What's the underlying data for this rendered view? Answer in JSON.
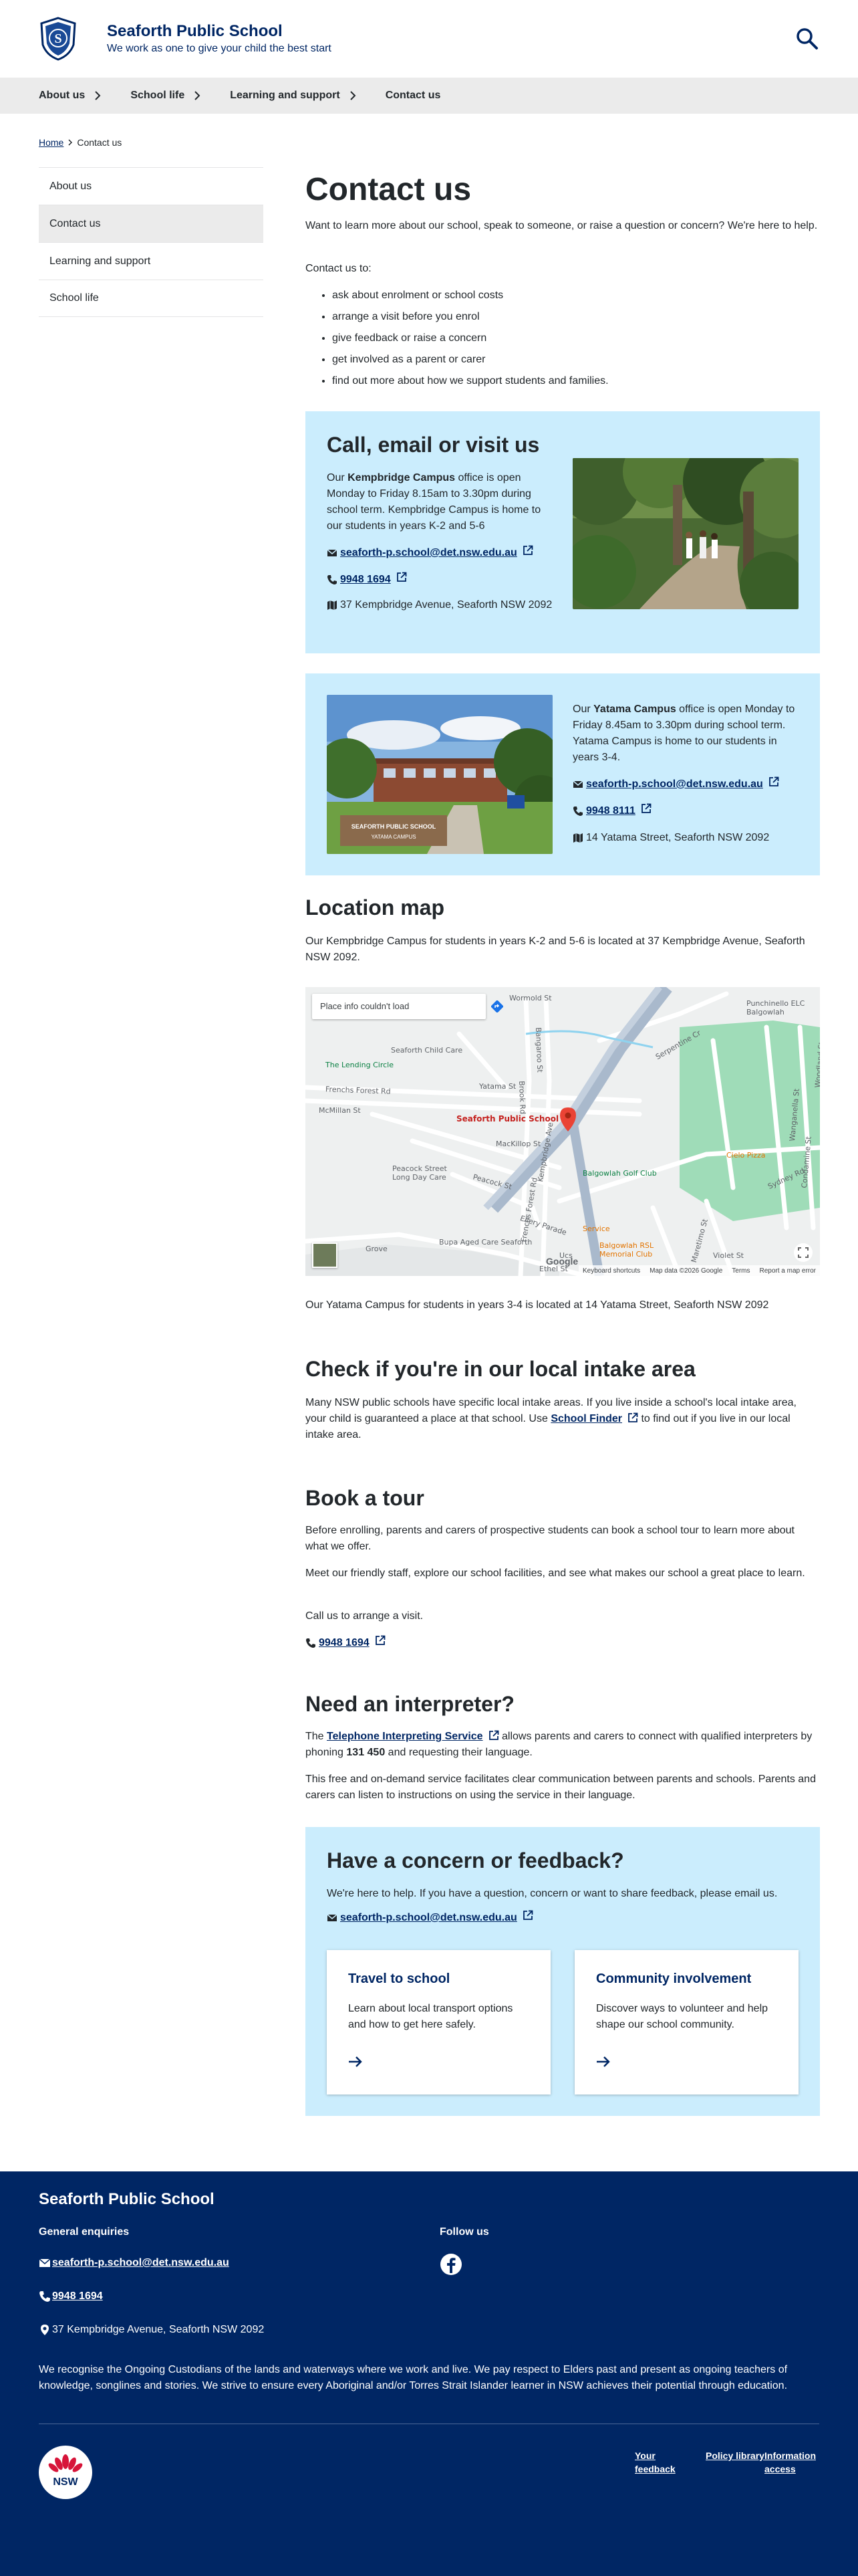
{
  "header": {
    "school_name": "Seaforth Public School",
    "tagline": "We work as one to give your child the best start",
    "crest_initial": "S"
  },
  "nav": {
    "items": [
      {
        "label": "About us",
        "has_chevron": true
      },
      {
        "label": "School life",
        "has_chevron": true
      },
      {
        "label": "Learning and support",
        "has_chevron": true
      },
      {
        "label": "Contact us",
        "has_chevron": false
      }
    ]
  },
  "breadcrumb": {
    "home": "Home",
    "current": "Contact us"
  },
  "sidebar": {
    "items": [
      {
        "label": "About us"
      },
      {
        "label": "Contact us",
        "active": true
      },
      {
        "label": "Learning and support"
      },
      {
        "label": "School life"
      }
    ]
  },
  "page": {
    "title": "Contact us",
    "intro": "Want to learn more about our school, speak to someone, or raise a question or concern? We're here to help.",
    "list_lead": "Contact us to:",
    "reasons": [
      "ask about enrolment or school costs",
      "arrange a visit before you enrol",
      "give feedback or raise a concern",
      "get involved as a parent or carer",
      "find out more about how we support students and families."
    ]
  },
  "contact": {
    "heading": "Call, email or visit us",
    "kempbridge": {
      "text_pre": "Our ",
      "name": "Kempbridge Campus",
      "text_post": " office is open Monday to Friday 8.15am to 3.30pm during school term. Kempbridge Campus is home to our students in years K-2 and 5-6",
      "email": "seaforth-p.school@det.nsw.edu.au",
      "phone": "9948 1694",
      "address": "37 Kempbridge Avenue, Seaforth NSW 2092"
    },
    "yatama": {
      "text_pre": "Our ",
      "name": "Yatama Campus",
      "text_post": " office is open Monday to Friday 8.45am to 3.30pm during school term. Yatama Campus is home to our students in years 3-4.",
      "email": "seaforth-p.school@det.nsw.edu.au",
      "phone": "9948 8111",
      "address": "14 Yatama Street, Seaforth NSW 2092",
      "sign_line1": "SEAFORTH PUBLIC SCHOOL",
      "sign_line2": "YATAMA CAMPUS"
    }
  },
  "location": {
    "heading": "Location map",
    "kempbridge_text": "Our Kempbridge Campus for students in years K-2 and 5-6 is located at 37 Kempbridge Avenue, Seaforth NSW 2092.",
    "yatama_text": "Our Yatama Campus for students in years 3-4 is located at 14 Yatama Street, Seaforth NSW 2092",
    "map": {
      "place_error": "Place info couldn't load",
      "marker_label": "Seaforth Public School",
      "labels": {
        "wormold": "Wormold St",
        "serpentine": "Serpentine Cr",
        "punchinello": "Punchinello ELC Balgowlah",
        "lending": "The Lending Circle",
        "childcare": "Seaforth Child Care",
        "frenchs1": "Frenchs Forest Rd",
        "frenchs2": "Frenchs Forest Rd",
        "mcmillan": "McMillan St",
        "yatama": "Yatama St",
        "mackillop": "MacKillop St",
        "peacock": "Peacock St",
        "peacock_ldc": "Peacock Street Long Day Care",
        "golf": "Balgowlah Golf Club",
        "cielo": "Cielo Pizza",
        "sydney": "Sydney Rd",
        "ellery": "Ellery Parade",
        "bupa": "Bupa Aged Care Seaforth",
        "rsl": "Balgowlah RSL Memorial Club",
        "ethel": "Ethel St",
        "grove": "Grove",
        "bangaroo": "Bangaroo St",
        "brook": "Brook Rd",
        "kempbridge": "Kempbridge Ave",
        "maretimo": "Maretimo St",
        "violet": "Violet St",
        "condamine": "Condamine St",
        "wanganella": "Wanganella St",
        "woodland": "Woodland St",
        "service": "Service",
        "ucs": "Ucs"
      },
      "google": "Google",
      "attribution": [
        "Keyboard shortcuts",
        "Map data ©2026 Google",
        "Terms",
        "Report a map error"
      ]
    }
  },
  "intake": {
    "heading": "Check if you're in our local intake area",
    "text_pre": "Many NSW public schools have specific local intake areas. If you live inside a school's local intake area, your child is guaranteed a place at that school. Use ",
    "link": "School Finder",
    "text_post": " to find out if you live in our local intake area."
  },
  "tour": {
    "heading": "Book a tour",
    "p1": "Before enrolling, parents and carers of prospective students can book a school tour to learn more about what we offer.",
    "p2": "Meet our friendly staff, explore our school facilities, and see what makes our school a great place to learn.",
    "p3": "Call us to arrange a visit.",
    "phone": "9948 1694"
  },
  "interpreter": {
    "heading": "Need an interpreter?",
    "text_pre": "The ",
    "link": "Telephone Interpreting Service",
    "text_mid": " allows parents and carers to connect with qualified interpreters by phoning ",
    "number": "131 450",
    "text_post": " and requesting their language.",
    "p2": "This free and on-demand service facilitates clear communication between parents and schools. Parents and carers can listen to instructions on using the service in their language."
  },
  "concern": {
    "heading": "Have a concern or feedback?",
    "text": "We're here to help. If you have a question, concern or want to share feedback, please email us.",
    "email": "seaforth-p.school@det.nsw.edu.au",
    "cards": [
      {
        "title": "Travel to school",
        "text": "Learn about local transport options and how to get here safely."
      },
      {
        "title": "Community involvement",
        "text": "Discover ways to volunteer and help shape our school community."
      }
    ]
  },
  "footer": {
    "school_name": "Seaforth Public School",
    "enquiries_heading": "General enquiries",
    "email": "seaforth-p.school@det.nsw.edu.au",
    "phone": "9948 1694",
    "address": "37 Kempbridge Avenue, Seaforth NSW 2092",
    "follow_heading": "Follow us",
    "acknowledgement": "We recognise the Ongoing Custodians of the lands and waterways where we work and live. We pay respect to Elders past and present as ongoing teachers of knowledge, songlines and stories. We strive to ensure every Aboriginal and/or Torres Strait Islander learner in NSW achieves their potential through education.",
    "nsw_logo": "NSW",
    "links": [
      "Your feedback",
      "Policy library",
      "Information access"
    ]
  },
  "colors": {
    "navy": "#002664",
    "panel": "#cbedfd",
    "nav_bg": "#ebebeb",
    "red": "#d7153a"
  }
}
